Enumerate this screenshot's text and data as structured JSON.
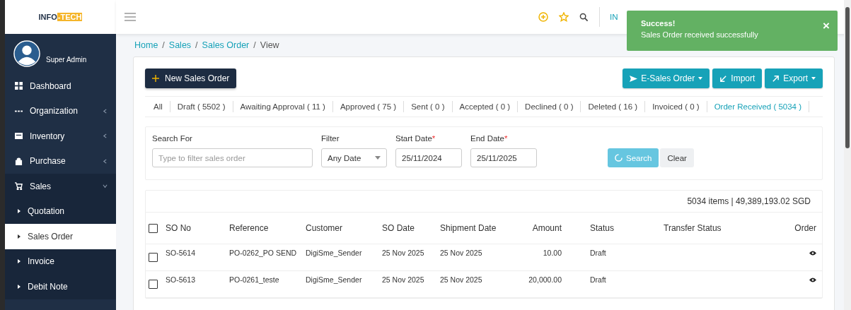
{
  "logo": {
    "part_1": "INFO",
    "part_2": "-TECH"
  },
  "user": {
    "name": "Super Admin"
  },
  "sidebar": {
    "items": [
      {
        "label": "Dashboard",
        "kind": "link",
        "selected": false
      },
      {
        "label": "Organization",
        "kind": "group",
        "expanded": false,
        "selected": false
      },
      {
        "label": "Inventory",
        "kind": "group",
        "expanded": false,
        "selected": false
      },
      {
        "label": "Purchase",
        "kind": "group",
        "expanded": false,
        "selected": false
      },
      {
        "label": "Sales",
        "kind": "group",
        "expanded": true,
        "selected": false
      },
      {
        "label": "Quotation",
        "kind": "sub",
        "selected": false
      },
      {
        "label": "Sales Order",
        "kind": "sub",
        "selected": true
      },
      {
        "label": "Invoice",
        "kind": "sub",
        "selected": false
      },
      {
        "label": "Debit Note",
        "kind": "sub",
        "selected": false
      }
    ]
  },
  "header": {
    "company": "IN"
  },
  "toast": {
    "title": "Success!",
    "message": "Sales Order received successfully",
    "close": "×"
  },
  "breadcrumb": [
    {
      "text": "Home",
      "kind": "link"
    },
    {
      "text": "/",
      "kind": "separator"
    },
    {
      "text": "Sales",
      "kind": "link"
    },
    {
      "text": "/",
      "kind": "separator"
    },
    {
      "text": "Sales Order",
      "kind": "link"
    },
    {
      "text": "/",
      "kind": "separator"
    },
    {
      "text": "View",
      "kind": "current"
    }
  ],
  "new_button": "New Sales Order",
  "action_buttons": [
    {
      "label": "E-Sales Order",
      "dropdown": true
    },
    {
      "label": "Import",
      "dropdown": false
    },
    {
      "label": "Export",
      "dropdown": true
    }
  ],
  "tabs": [
    {
      "label": "All",
      "selected": false
    },
    {
      "label": "Draft ( 5502 )",
      "selected": false
    },
    {
      "label": "Awaiting Approval ( 11 )",
      "selected": false
    },
    {
      "label": "Approved ( 75 )",
      "selected": false
    },
    {
      "label": "Sent ( 0 )",
      "selected": false
    },
    {
      "label": "Accepted ( 0 )",
      "selected": false
    },
    {
      "label": "Declined ( 0 )",
      "selected": false
    },
    {
      "label": "Deleted ( 16 )",
      "selected": false
    },
    {
      "label": "Invoiced ( 0 )",
      "selected": false
    },
    {
      "label": "Order Received ( 5034 )",
      "selected": true
    }
  ],
  "search": {
    "search_label": "Search For",
    "placeholder": "Type to filter sales order",
    "filter_label": "Filter",
    "filter_value": "Any Date",
    "start_label": "Start Date",
    "start_value": "25/11/2024",
    "end_label": "End Date",
    "end_value": "25/11/2025",
    "required_mark": "*",
    "search_button": "Search",
    "loading": true,
    "clear_button": "Clear"
  },
  "table": {
    "summary": "5034 items | 49,389,193.02 SGD",
    "all_checked": false,
    "columns": [
      "SO No",
      "Reference",
      "Customer",
      "SO Date",
      "Shipment Date",
      "Amount",
      "Status",
      "Transfer Status",
      "Order"
    ],
    "rows": [
      {
        "checked": false,
        "cells": [
          "SO-5614",
          "PO-0262_PO SEND",
          "DigiSme_Sender",
          "25 Nov 2025",
          "25 Nov 2025",
          "10.00",
          "Draft",
          ""
        ]
      },
      {
        "checked": false,
        "cells": [
          "SO-5613",
          "PO-0261_teste",
          "DigiSme_Sender",
          "25 Nov 2025",
          "25 Nov 2025",
          "20,000.00",
          "Draft",
          ""
        ]
      }
    ]
  }
}
